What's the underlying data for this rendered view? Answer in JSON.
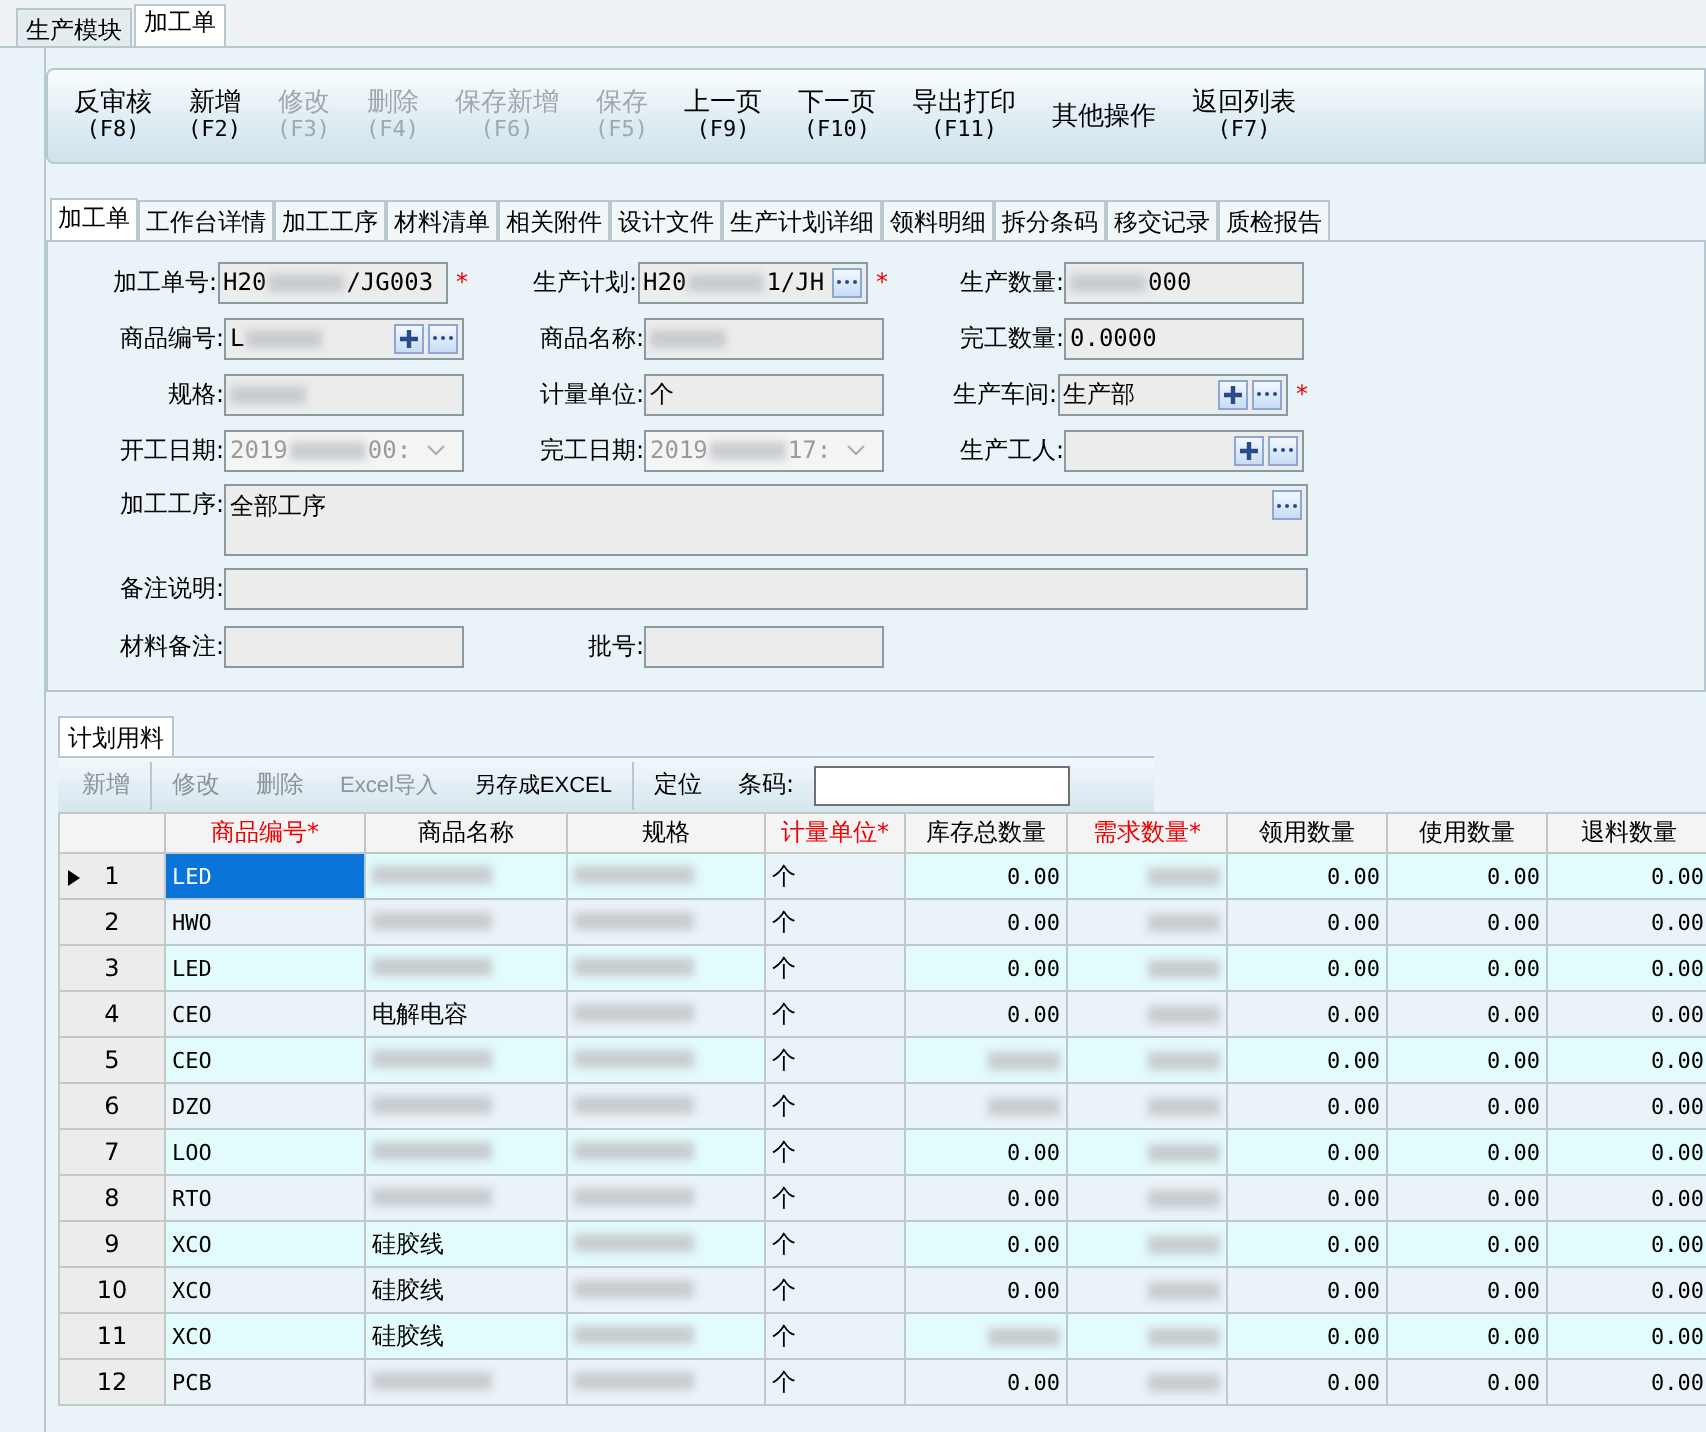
{
  "module_tabs": [
    {
      "label": "生产模块",
      "selected": false
    },
    {
      "label": "加工单",
      "selected": true
    }
  ],
  "toolbar": [
    {
      "label": "反审核",
      "key": "(F8)",
      "disabled": false
    },
    {
      "label": "新增",
      "key": "(F2)",
      "disabled": false
    },
    {
      "label": "修改",
      "key": "(F3)",
      "disabled": true
    },
    {
      "label": "删除",
      "key": "(F4)",
      "disabled": true
    },
    {
      "label": "保存新增",
      "key": "(F6)",
      "disabled": true
    },
    {
      "label": "保存",
      "key": "(F5)",
      "disabled": true
    },
    {
      "label": "上一页",
      "key": "(F9)",
      "disabled": false
    },
    {
      "label": "下一页",
      "key": "(F10)",
      "disabled": false
    },
    {
      "label": "导出打印",
      "key": "(F11)",
      "disabled": false
    },
    {
      "label": "其他操作",
      "disabled": false
    },
    {
      "label": "返回列表",
      "key": "(F7)",
      "disabled": false
    }
  ],
  "detail_tabs": [
    {
      "label": "加工单",
      "selected": true
    },
    {
      "label": "工作台详情",
      "selected": false
    },
    {
      "label": "加工工序",
      "selected": false
    },
    {
      "label": "材料清单",
      "selected": false
    },
    {
      "label": "相关附件",
      "selected": false
    },
    {
      "label": "设计文件",
      "selected": false
    },
    {
      "label": "生产计划详细",
      "selected": false
    },
    {
      "label": "领料明细",
      "selected": false
    },
    {
      "label": "拆分条码",
      "selected": false
    },
    {
      "label": "移交记录",
      "selected": false
    },
    {
      "label": "质检报告",
      "selected": false
    }
  ],
  "form_rows": [
    [
      {
        "label": "加工单号:",
        "kind": "text",
        "value": "H20",
        "redacted": true,
        "value_end": "/JG003",
        "required_mark": "*"
      },
      {
        "label": "生产计划:",
        "kind": "lookup",
        "value": "H20",
        "redacted": true,
        "value_end": "1/JH",
        "required_mark": "*"
      },
      {
        "label": "生产数量:",
        "kind": "text",
        "redacted": true,
        "value_end": "000"
      }
    ],
    [
      {
        "label": "商品编号:",
        "kind": "picker",
        "value": "L",
        "redacted": true
      },
      {
        "label": "商品名称:",
        "kind": "text",
        "redacted": true
      },
      {
        "label": "完工数量:",
        "kind": "text",
        "value": "0.0000"
      }
    ],
    [
      {
        "label": "规格:",
        "kind": "text",
        "redacted": true
      },
      {
        "label": "计量单位:",
        "kind": "text",
        "value": "个"
      },
      {
        "label": "生产车间:",
        "kind": "picker",
        "value": "生产部",
        "required_mark": "*"
      }
    ],
    [
      {
        "label": "开工日期:",
        "kind": "date",
        "value": "2019",
        "redacted": true,
        "value_end": "00:",
        "disabled": true
      },
      {
        "label": "完工日期:",
        "kind": "date",
        "value": "2019",
        "redacted": true,
        "value_end": "17:",
        "disabled": true
      },
      {
        "label": "生产工人:",
        "kind": "picker"
      }
    ]
  ],
  "process": {
    "label": "加工工序:",
    "value": "全部工序"
  },
  "note": {
    "label": "备注说明:"
  },
  "last_row": [
    {
      "label": "材料备注:"
    },
    {
      "label": "批号:"
    }
  ],
  "grid_tab": {
    "label": "计划用料",
    "selected": true
  },
  "grid_toolbar": [
    {
      "label": "新增",
      "disabled": true
    },
    {
      "label": "修改",
      "disabled": true
    },
    {
      "label": "删除",
      "disabled": true
    },
    {
      "label": "Excel导入",
      "disabled": true
    },
    {
      "label": "另存成EXCEL",
      "disabled": false
    },
    {
      "label": "定位",
      "disabled": false
    }
  ],
  "barcode": {
    "label": "条码:"
  },
  "columns": [
    {
      "label": "商品编号*",
      "required": true
    },
    {
      "label": "商品名称",
      "required": false
    },
    {
      "label": "规格",
      "required": false
    },
    {
      "label": "计量单位*",
      "required": true
    },
    {
      "label": "库存总数量",
      "required": false
    },
    {
      "label": "需求数量*",
      "required": true
    },
    {
      "label": "领用数量",
      "required": false
    },
    {
      "label": "使用数量",
      "required": false
    },
    {
      "label": "退料数量",
      "required": false
    }
  ],
  "rows": [
    {
      "no": "1",
      "selected": true,
      "code": "LED",
      "unit": "个",
      "stock": "0.00",
      "used": "0.00",
      "consumed": "0.00",
      "returned": "0.00"
    },
    {
      "no": "2",
      "selected": false,
      "code": "HWO",
      "unit": "个",
      "stock": "0.00",
      "used": "0.00",
      "consumed": "0.00",
      "returned": "0.00"
    },
    {
      "no": "3",
      "selected": false,
      "code": "LED",
      "unit": "个",
      "stock": "0.00",
      "used": "0.00",
      "consumed": "0.00",
      "returned": "0.00"
    },
    {
      "no": "4",
      "selected": false,
      "code": "CEO",
      "name": "电解电容",
      "unit": "个",
      "stock": "0.00",
      "used": "0.00",
      "consumed": "0.00",
      "returned": "0.00"
    },
    {
      "no": "5",
      "selected": false,
      "code": "CEO",
      "unit": "个",
      "used": "0.00",
      "consumed": "0.00",
      "returned": "0.00"
    },
    {
      "no": "6",
      "selected": false,
      "code": "DZO",
      "unit": "个",
      "used": "0.00",
      "consumed": "0.00",
      "returned": "0.00"
    },
    {
      "no": "7",
      "selected": false,
      "code": "LOO",
      "unit": "个",
      "stock": "0.00",
      "used": "0.00",
      "consumed": "0.00",
      "returned": "0.00"
    },
    {
      "no": "8",
      "selected": false,
      "code": "RTO",
      "unit": "个",
      "stock": "0.00",
      "used": "0.00",
      "consumed": "0.00",
      "returned": "0.00"
    },
    {
      "no": "9",
      "selected": false,
      "code": "XCO",
      "name": "硅胶线",
      "unit": "个",
      "stock": "0.00",
      "used": "0.00",
      "consumed": "0.00",
      "returned": "0.00"
    },
    {
      "no": "10",
      "selected": false,
      "code": "XCO",
      "name": "硅胶线",
      "unit": "个",
      "stock": "0.00",
      "used": "0.00",
      "consumed": "0.00",
      "returned": "0.00"
    },
    {
      "no": "11",
      "selected": false,
      "code": "XCO",
      "name": "硅胶线",
      "unit": "个",
      "used": "0.00",
      "consumed": "0.00",
      "returned": "0.00"
    },
    {
      "no": "12",
      "selected": false,
      "code": "PCB",
      "unit": "个",
      "stock": "0.00",
      "used": "0.00",
      "consumed": "0.00",
      "returned": "0.00"
    }
  ]
}
